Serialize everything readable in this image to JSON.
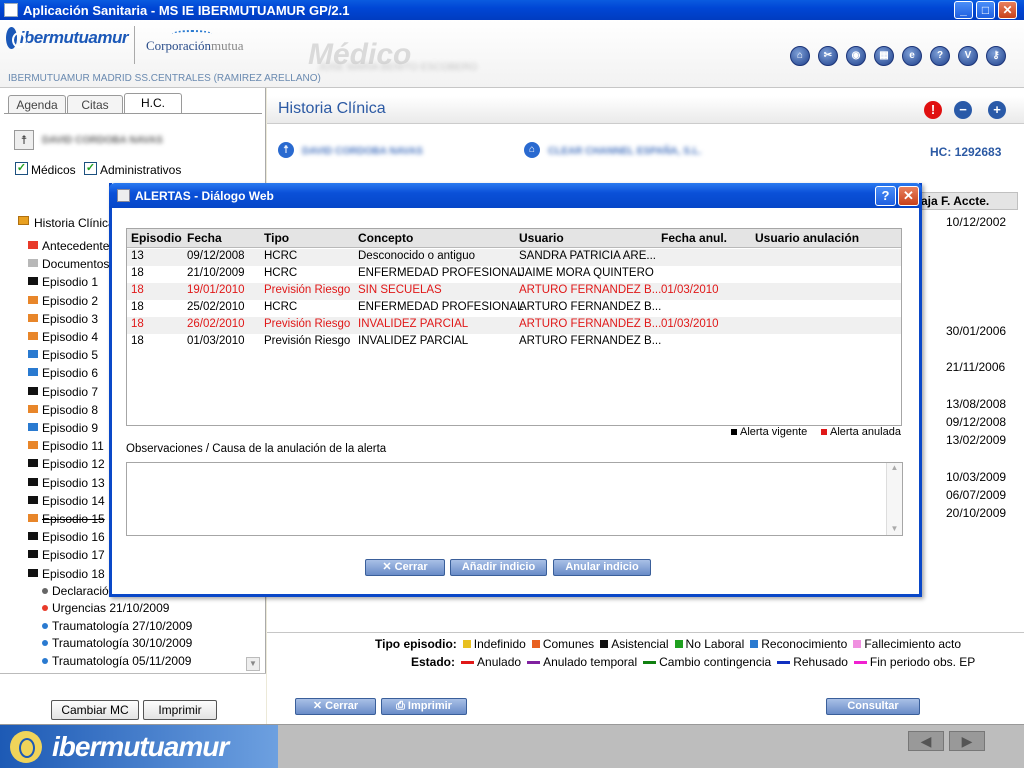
{
  "window": {
    "title": "Aplicación Sanitaria - MS IE IBERMUTUAMUR GP/2.1"
  },
  "header": {
    "logo_ib": "ibermutuamur",
    "logo_cm_a": "Corporación",
    "logo_cm_b": "mutua",
    "medico": "Médico",
    "medico_name": "JOSE MARIA BENITO ESCOBERO",
    "subheader": "IBERMUTUAMUR MADRID SS.CENTRALES (RAMIREZ ARELLANO)",
    "icons": [
      "home-icon",
      "tools-icon",
      "location-icon",
      "calculator-icon",
      "internet-explorer-icon",
      "help-icon",
      "v-icon",
      "key-icon"
    ]
  },
  "left": {
    "tabs": [
      "Agenda",
      "Citas",
      "H.C."
    ],
    "patient": "DAVID CORDOBA NAVAS",
    "check_medicos": "Médicos",
    "check_admin": "Administrativos",
    "tree_root": "Historia Clínica",
    "tree": [
      {
        "label": "Antecedentes",
        "color": "#e83a2a"
      },
      {
        "label": "Documentos",
        "color": "#b8b8b8"
      },
      {
        "label": "Episodio 1",
        "color": "#111111"
      },
      {
        "label": "Episodio 2",
        "color": "#e8862a"
      },
      {
        "label": "Episodio 3",
        "color": "#e8862a"
      },
      {
        "label": "Episodio 4",
        "color": "#e8862a"
      },
      {
        "label": "Episodio 5",
        "color": "#2a7ad0"
      },
      {
        "label": "Episodio 6",
        "color": "#2a7ad0"
      },
      {
        "label": "Episodio 7",
        "color": "#111111"
      },
      {
        "label": "Episodio 8",
        "color": "#e8862a"
      },
      {
        "label": "Episodio 9",
        "color": "#2a7ad0"
      },
      {
        "label": "Episodio 11",
        "color": "#e8862a"
      },
      {
        "label": "Episodio 12",
        "color": "#111111"
      },
      {
        "label": "Episodio 13",
        "color": "#111111"
      },
      {
        "label": "Episodio 14",
        "color": "#111111"
      },
      {
        "label": "Episodio 15",
        "color": "#e8862a"
      },
      {
        "label": "Episodio 16",
        "color": "#111111"
      },
      {
        "label": "Episodio 17",
        "color": "#111111"
      },
      {
        "label": "Episodio 18",
        "color": "#111111"
      }
    ],
    "subtree": [
      {
        "label": "Declaración",
        "color": "#666666"
      },
      {
        "label": "Urgencias 21/10/2009",
        "color": "#e83a2a"
      },
      {
        "label": "Traumatología 27/10/2009",
        "color": "#2a7ad0"
      },
      {
        "label": "Traumatología 30/10/2009",
        "color": "#2a7ad0"
      },
      {
        "label": "Traumatología 05/11/2009",
        "color": "#2a7ad0"
      }
    ],
    "btn_cambiar": "Cambiar MC",
    "btn_imprimir": "Imprimir"
  },
  "right": {
    "title": "Historia Clínica",
    "patient_blur": "DAVID CORDOBA NAVAS",
    "company_blur": "CLEAR CHANNEL ESPAÑA, S.L.",
    "hc_label": "HC: 1292683",
    "col_head": "aja F. Accte.",
    "dates": [
      "10/12/2002",
      "30/01/2006",
      "21/11/2006",
      "13/08/2008",
      "09/12/2008",
      "13/02/2009",
      "10/03/2009",
      "06/07/2009",
      "20/10/2009"
    ],
    "tipo_label": "Tipo episodio:",
    "tipo": [
      {
        "label": "Indefinido",
        "color": "#e8c020"
      },
      {
        "label": "Comunes",
        "color": "#e86020"
      },
      {
        "label": "Asistencial",
        "color": "#111111"
      },
      {
        "label": "No Laboral",
        "color": "#20a020"
      },
      {
        "label": "Reconocimiento",
        "color": "#2a7ad0"
      },
      {
        "label": "Fallecimiento acto",
        "color": "#f090e0"
      }
    ],
    "estado_label": "Estado:",
    "estado": [
      {
        "label": "Anulado",
        "color": "#e01818"
      },
      {
        "label": "Anulado temporal",
        "color": "#8020a0"
      },
      {
        "label": "Cambio contingencia",
        "color": "#108010"
      },
      {
        "label": "Rehusado",
        "color": "#1030c0"
      },
      {
        "label": "Fin periodo obs. EP",
        "color": "#f020d0"
      }
    ],
    "btn_cerrar": "Cerrar",
    "btn_imprimir": "Imprimir",
    "btn_consultar": "Consultar"
  },
  "dialog": {
    "title": "ALERTAS - Diálogo Web",
    "columns": [
      "Episodio",
      "Fecha",
      "Tipo",
      "Concepto",
      "Usuario",
      "Fecha anul.",
      "Usuario anulación"
    ],
    "rows": [
      {
        "ep": "13",
        "fecha": "09/12/2008",
        "tipo": "HCRC",
        "concepto": "Desconocido o antiguo",
        "usuario": "SANDRA PATRICIA ARE...",
        "fanul": "",
        "uanul": "",
        "anulada": false
      },
      {
        "ep": "18",
        "fecha": "21/10/2009",
        "tipo": "HCRC",
        "concepto": "ENFERMEDAD PROFESIONAL",
        "usuario": "JAIME MORA QUINTERO",
        "fanul": "",
        "uanul": "",
        "anulada": false
      },
      {
        "ep": "18",
        "fecha": "19/01/2010",
        "tipo": "Previsión Riesgo",
        "concepto": "SIN SECUELAS",
        "usuario": "ARTURO FERNANDEZ B...",
        "fanul": "01/03/2010",
        "uanul": "",
        "anulada": true
      },
      {
        "ep": "18",
        "fecha": "25/02/2010",
        "tipo": "HCRC",
        "concepto": "ENFERMEDAD PROFESIONAL",
        "usuario": "ARTURO FERNANDEZ B...",
        "fanul": "",
        "uanul": "",
        "anulada": false
      },
      {
        "ep": "18",
        "fecha": "26/02/2010",
        "tipo": "Previsión Riesgo",
        "concepto": "INVALIDEZ PARCIAL",
        "usuario": "ARTURO FERNANDEZ B...",
        "fanul": "01/03/2010",
        "uanul": "",
        "anulada": true
      },
      {
        "ep": "18",
        "fecha": "01/03/2010",
        "tipo": "Previsión Riesgo",
        "concepto": "INVALIDEZ PARCIAL",
        "usuario": "ARTURO FERNANDEZ B...",
        "fanul": "",
        "uanul": "",
        "anulada": false
      }
    ],
    "legend_vigente": "Alerta vigente",
    "legend_anulada": "Alerta anulada",
    "obs_label": "Observaciones / Causa de la anulación de la alerta",
    "obs_value": "",
    "btn_cerrar": "Cerrar",
    "btn_anadir": "Añadir indicio",
    "btn_anular": "Anular indicio"
  },
  "statusbar": {
    "logo": "ibermutuamur"
  }
}
